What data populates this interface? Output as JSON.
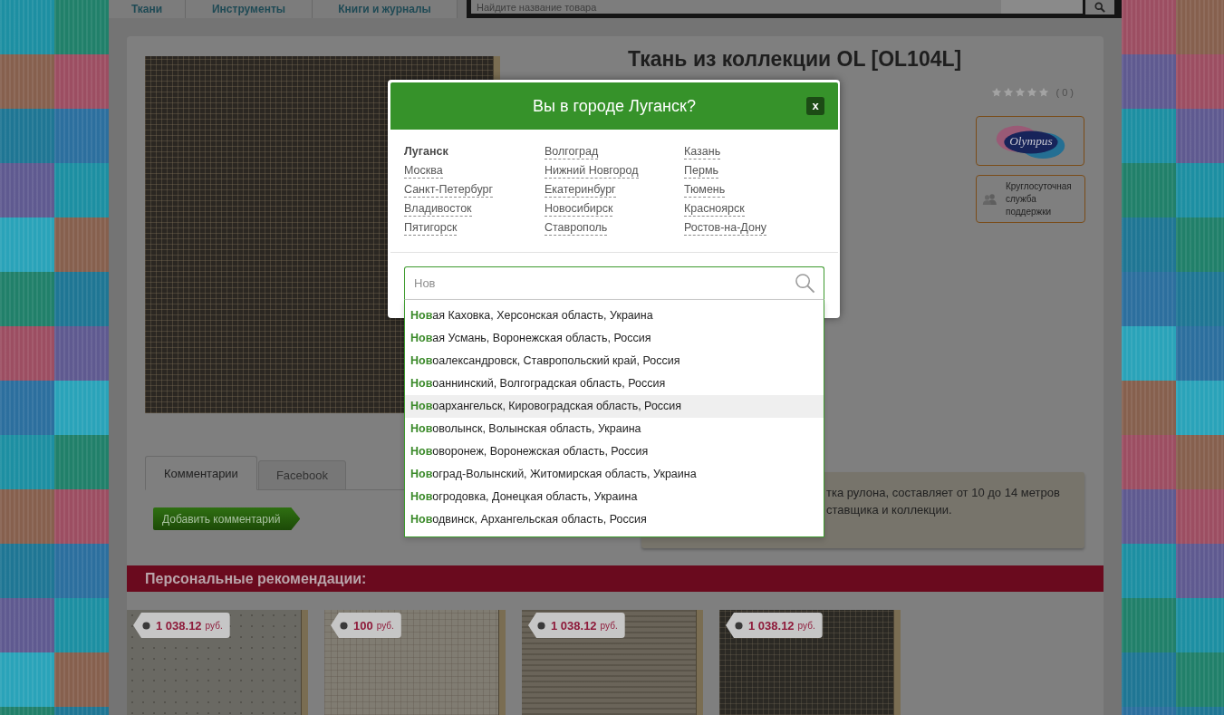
{
  "top_nav": {
    "tabs": [
      {
        "label": "Ткани"
      },
      {
        "label": "Инструменты"
      },
      {
        "label": "Книги и журналы"
      }
    ],
    "search": {
      "placeholder": "Найдите название товара"
    }
  },
  "product": {
    "title": "Ткань из коллекции OL [OL104L]",
    "rating": {
      "stars": 0,
      "count": "( 0 )"
    },
    "brand_logo": {
      "text": "Olympus"
    },
    "support": {
      "lines": [
        "Круглосуточная",
        "служба",
        "поддержки"
      ]
    }
  },
  "comment_tabs": [
    {
      "label": "Комментарии",
      "selected": true
    },
    {
      "label": "Facebook",
      "selected": false
    }
  ],
  "add_comment_button": {
    "label": "Добавить комментарий"
  },
  "note": {
    "lines": [
      "тка рулона, составляет от 10 до 14 метров",
      "ставщика и коллекции."
    ]
  },
  "recommendations": {
    "title": "Персональные рекомендации:",
    "items": [
      {
        "price": "1 038.12",
        "currency": "руб."
      },
      {
        "price": "100",
        "currency": "руб."
      },
      {
        "price": "1 038.12",
        "currency": "руб."
      },
      {
        "price": "1 038.12",
        "currency": "руб."
      }
    ]
  },
  "city_dialog": {
    "title": "Вы в городе Луганск?",
    "close": "x",
    "cities": [
      {
        "name": "Луганск",
        "selected": true
      },
      {
        "name": "Волгоград",
        "selected": false
      },
      {
        "name": "Казань",
        "selected": false
      },
      {
        "name": "Москва",
        "selected": false
      },
      {
        "name": "Нижний Новгород",
        "selected": false
      },
      {
        "name": "Пермь",
        "selected": false
      },
      {
        "name": "Санкт-Петербург",
        "selected": false
      },
      {
        "name": "Екатеринбург",
        "selected": false
      },
      {
        "name": "Тюмень",
        "selected": false
      },
      {
        "name": "Владивосток",
        "selected": false
      },
      {
        "name": "Новосибирск",
        "selected": false
      },
      {
        "name": "Красноярск",
        "selected": false
      },
      {
        "name": "Пятигорск",
        "selected": false
      },
      {
        "name": "Ставрополь",
        "selected": false
      },
      {
        "name": "Ростов-на-Дону",
        "selected": false
      }
    ],
    "search": {
      "value": "Нов"
    },
    "suggestions": [
      {
        "text": "**Нов**ая Каховка, Херсонская область, Украина",
        "highlighted": false
      },
      {
        "text": "**Нов**ая Усмань, Воронежская область, Россия",
        "highlighted": false
      },
      {
        "text": "**Нов**оалександровск, Ставропольский край, Россия",
        "highlighted": false
      },
      {
        "text": "**Нов**оаннинский, Волгоградская область, Россия",
        "highlighted": false
      },
      {
        "text": "**Нов**оархангельск, Кировоградская область, Россия",
        "highlighted": true
      },
      {
        "text": "**Нов**оволынск, Волынская область, Украина",
        "highlighted": false
      },
      {
        "text": "**Нов**оворонеж, Воронежская область, Россия",
        "highlighted": false
      },
      {
        "text": "**Нов**оград-Волынский, Житомирская область, Украина",
        "highlighted": false
      },
      {
        "text": "**Нов**огродовка, Донецкая область, Украина",
        "highlighted": false
      },
      {
        "text": "**Нов**одвинск, Архангельская область, Россия",
        "highlighted": false
      }
    ]
  }
}
